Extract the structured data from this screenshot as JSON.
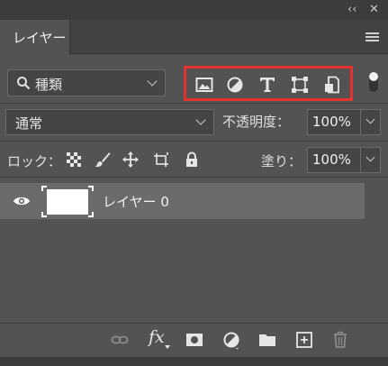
{
  "window": {
    "collapse_icon": "double-chevron-left-icon",
    "close_icon": "close-icon",
    "collapse_glyph": "‹‹",
    "close_glyph": "✕"
  },
  "tabs": [
    {
      "label": "レイヤー",
      "active": true
    }
  ],
  "panel_menu_icon": "hamburger-menu-icon",
  "filter": {
    "kind_label": "種類",
    "icons": [
      "image-filter-icon",
      "adjustment-filter-icon",
      "type-filter-icon",
      "shape-filter-icon",
      "smart-object-filter-icon"
    ],
    "highlight_color": "#e2332e"
  },
  "blend": {
    "mode": "通常",
    "opacity_label": "不透明度：",
    "opacity_value": "100%"
  },
  "lock": {
    "label": "ロック：",
    "icons": [
      "lock-transparent-pixels-icon",
      "lock-image-pixels-icon",
      "lock-position-icon",
      "lock-artboard-icon",
      "lock-all-icon"
    ],
    "fill_label": "塗り：",
    "fill_value": "100%"
  },
  "layers": [
    {
      "name": "レイヤー 0",
      "visible": true,
      "selected": true
    }
  ],
  "bottom_icons": [
    "link-icon",
    "fx-icon",
    "mask-icon",
    "adjustment-layer-icon",
    "folder-icon",
    "new-layer-icon",
    "trash-icon"
  ],
  "fx_label": "fx"
}
